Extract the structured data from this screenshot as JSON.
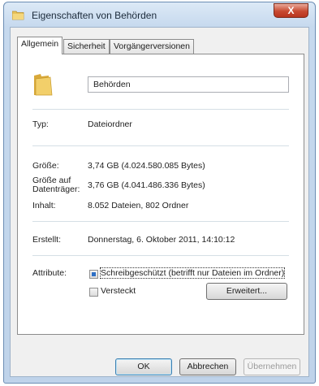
{
  "window": {
    "title": "Eigenschaften von Behörden",
    "close_label": "X"
  },
  "tabs": [
    {
      "label": "Allgemein",
      "active": true
    },
    {
      "label": "Sicherheit",
      "active": false
    },
    {
      "label": "Vorgängerversionen",
      "active": false
    }
  ],
  "general": {
    "folder_name": "Behörden",
    "type_label": "Typ:",
    "type_value": "Dateiordner",
    "size_label": "Größe:",
    "size_value": "3,74 GB (4.024.580.085 Bytes)",
    "size_on_disk_label_1": "Größe auf",
    "size_on_disk_label_2": "Datenträger:",
    "size_on_disk_value": "3,76 GB (4.041.486.336 Bytes)",
    "contents_label": "Inhalt:",
    "contents_value": "8.052 Dateien, 802 Ordner",
    "created_label": "Erstellt:",
    "created_value": "Donnerstag, 6. Oktober 2011, 14:10:12",
    "attributes_label": "Attribute:",
    "readonly_label": "Schreibgeschützt (betrifft nur Dateien im Ordner)",
    "readonly_state": "indeterminate",
    "hidden_label": "Versteckt",
    "hidden_state": "unchecked",
    "advanced_button": "Erweitert..."
  },
  "footer": {
    "ok": "OK",
    "cancel": "Abbrechen",
    "apply": "Übernehmen"
  },
  "colors": {
    "title_bar": "#c6d9ee",
    "close_button": "#c84a31",
    "folder": "#e8c25a",
    "checkbox_fill": "#2d6fc5"
  },
  "icons": {
    "title": "folder-icon",
    "general": "folder-icon"
  }
}
